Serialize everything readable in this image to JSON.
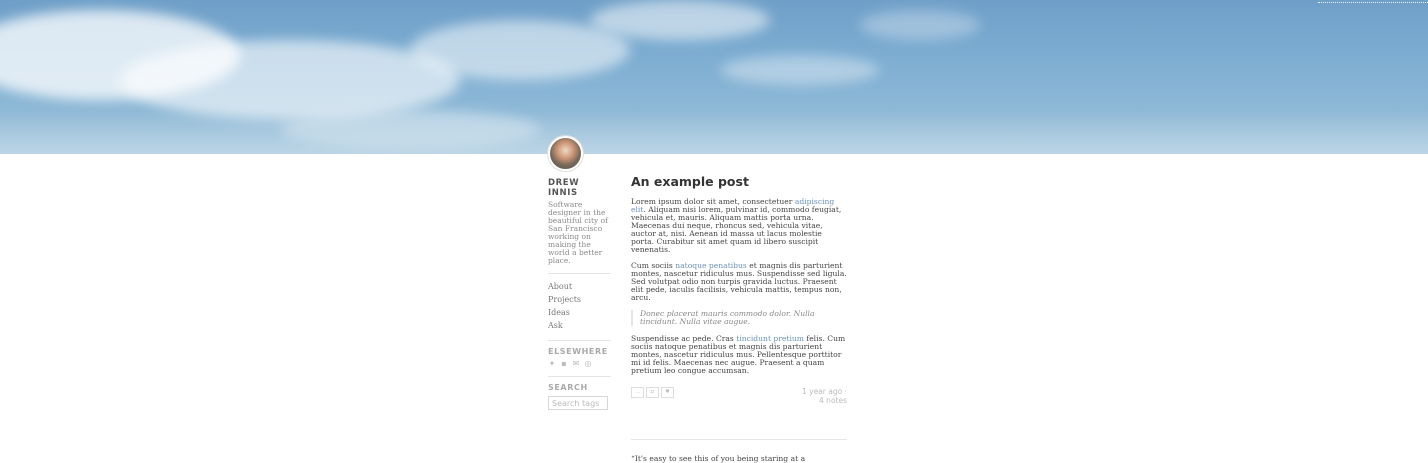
{
  "author": {
    "name": "DREW INNIS",
    "bio": "Software designer in the beautiful city of San Francisco working on making the world a better place."
  },
  "nav": {
    "items": [
      "About",
      "Projects",
      "Ideas",
      "Ask"
    ]
  },
  "elsewhere": {
    "title": "ELSEWHERE",
    "icons": [
      "twitter-icon",
      "facebook-icon",
      "mail-icon",
      "dribbble-icon"
    ]
  },
  "search": {
    "title": "SEARCH",
    "placeholder": "Search tags"
  },
  "post": {
    "title": "An example post",
    "p1_a": "Lorem ipsum dolor sit amet, consectetuer ",
    "p1_link": "adipiscing elit",
    "p1_b": ". Aliquam nisi lorem, pulvinar id, commodo feugiat, vehicula et, mauris. Aliquam mattis porta urna. Maecenas dui neque, rhoncus sed, vehicula vitae, auctor at, nisi. Aenean id massa ut lacus molestie porta. Curabitur sit amet quam id libero suscipit venenatis.",
    "p2_a": "Cum sociis ",
    "p2_link": "natoque penatibus",
    "p2_b": " et magnis dis parturient montes, nascetur ridiculus mus. Suspendisse sed ligula. Sed volutpat odio non turpis gravida luctus. Praesent elit pede, iaculis facilisis, vehicula mattis, tempus non, arcu.",
    "quote": "Donec placerat mauris commodo dolor. Nulla tincidunt. Nulla vitae augue.",
    "p3_a": "Suspendisse ac pede. Cras ",
    "p3_link": "tincidunt pretium",
    "p3_b": " felis. Cum sociis natoque penatibus et magnis dis parturient montes, nascetur ridiculus mus. Pellentesque porttitor mi id felis. Maecenas nec augue. Praesent a quam pretium leo congue accumsan.",
    "meta_time": "1 year ago ·",
    "meta_notes": "4 notes",
    "share_icons": [
      "permalink-icon",
      "reblog-icon",
      "like-icon"
    ]
  },
  "next_post": {
    "text": "“It's easy to see this of you being staring at a"
  },
  "colors": {
    "link": "#6b93ba",
    "sky": "#7eaed2"
  }
}
